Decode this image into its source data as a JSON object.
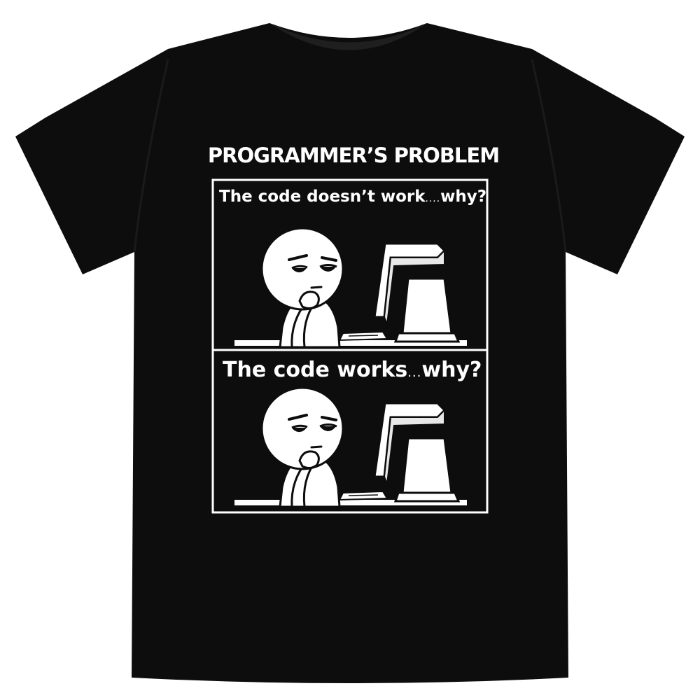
{
  "image": {
    "subject": "black t-shirt",
    "background_color": "#ffffff",
    "shirt_color": "#0d0d0d",
    "print_color": "#ffffff"
  },
  "print": {
    "title": "PROGRAMMER’S PROBLEM",
    "panels": [
      {
        "caption_start": "The code doesn’t work",
        "caption_dots": "....",
        "caption_end": "why?"
      },
      {
        "caption_start": "The code works",
        "caption_dots": "...",
        "caption_end": "why?"
      }
    ]
  }
}
